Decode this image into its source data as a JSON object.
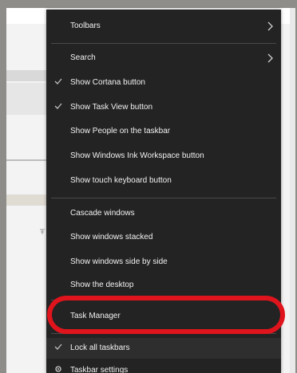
{
  "menu": {
    "items": [
      {
        "label": "Toolbars",
        "checked": false,
        "submenu": true
      },
      {
        "label": "Search",
        "checked": false,
        "submenu": true
      },
      {
        "label": "Show Cortana button",
        "checked": true,
        "submenu": false
      },
      {
        "label": "Show Task View button",
        "checked": true,
        "submenu": false
      },
      {
        "label": "Show People on the taskbar",
        "checked": false,
        "submenu": false
      },
      {
        "label": "Show Windows Ink Workspace button",
        "checked": false,
        "submenu": false
      },
      {
        "label": "Show touch keyboard button",
        "checked": false,
        "submenu": false
      },
      {
        "label": "Cascade windows",
        "checked": false,
        "submenu": false
      },
      {
        "label": "Show windows stacked",
        "checked": false,
        "submenu": false
      },
      {
        "label": "Show windows side by side",
        "checked": false,
        "submenu": false
      },
      {
        "label": "Show the desktop",
        "checked": false,
        "submenu": false
      },
      {
        "label": "Task Manager",
        "checked": false,
        "submenu": false
      },
      {
        "label": "Lock all taskbars",
        "checked": true,
        "submenu": false
      },
      {
        "label": "Taskbar settings",
        "checked": false,
        "submenu": false
      }
    ]
  },
  "colors": {
    "menu_background": "#232323",
    "menu_text": "#f2f2f2",
    "highlight_ring": "#e0141c",
    "check_mark": "#bdbdbd"
  },
  "icons": {
    "check": "check-icon",
    "submenu": "chevron-right-icon",
    "settings": "gear-icon"
  }
}
